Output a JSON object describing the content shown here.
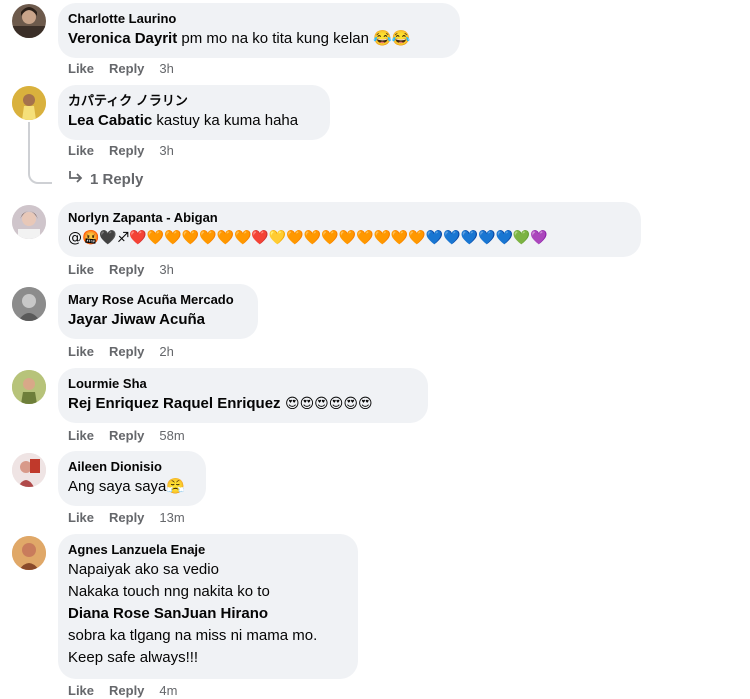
{
  "comments": [
    {
      "author": "Charlotte Laurino",
      "mention": "Veronica Dayrit",
      "text": " pm mo na ko tita kung kelan 😂😂",
      "like": "Like",
      "reply": "Reply",
      "time": "3h"
    },
    {
      "author": "カパティク ノラリン",
      "mention": "Lea Cabatic",
      "text": " kastuy ka kuma haha",
      "like": "Like",
      "reply": "Reply",
      "time": "3h",
      "replies_link": "1 Reply"
    },
    {
      "author": "Norlyn Zapanta - Abigan",
      "text": "@🤬🖤♐❤️🧡🧡🧡🧡🧡🧡❤️💛🧡🧡🧡🧡🧡🧡🧡🧡💙💙💙💙💙💚💜",
      "like": "Like",
      "reply": "Reply",
      "time": "3h"
    },
    {
      "author": "Mary Rose Acuña Mercado",
      "mention": "Jayar Jiwaw Acuña",
      "like": "Like",
      "reply": "Reply",
      "time": "2h"
    },
    {
      "author": "Lourmie Sha",
      "mention": "Rej Enriquez Raquel Enriquez",
      "text": " 😍😍😍😍😍😍",
      "like": "Like",
      "reply": "Reply",
      "time": "58m"
    },
    {
      "author": "Aileen Dionisio",
      "text": "Ang saya saya😤",
      "like": "Like",
      "reply": "Reply",
      "time": "13m"
    },
    {
      "author": "Agnes Lanzuela Enaje",
      "line1": "Napaiyak ako sa vedio",
      "line2": "Nakaka touch nng nakita ko to",
      "mention": "Diana Rose SanJuan Hirano",
      "line4": "sobra ka tlgang na miss ni mama mo.",
      "line5": "Keep safe always!!!",
      "like": "Like",
      "reply": "Reply",
      "time": "4m"
    }
  ],
  "colors": {
    "bubble": "#f0f2f5",
    "meta": "#65676b",
    "text": "#050505"
  },
  "icons": {
    "reply_arrow": "reply-arrow-icon"
  }
}
